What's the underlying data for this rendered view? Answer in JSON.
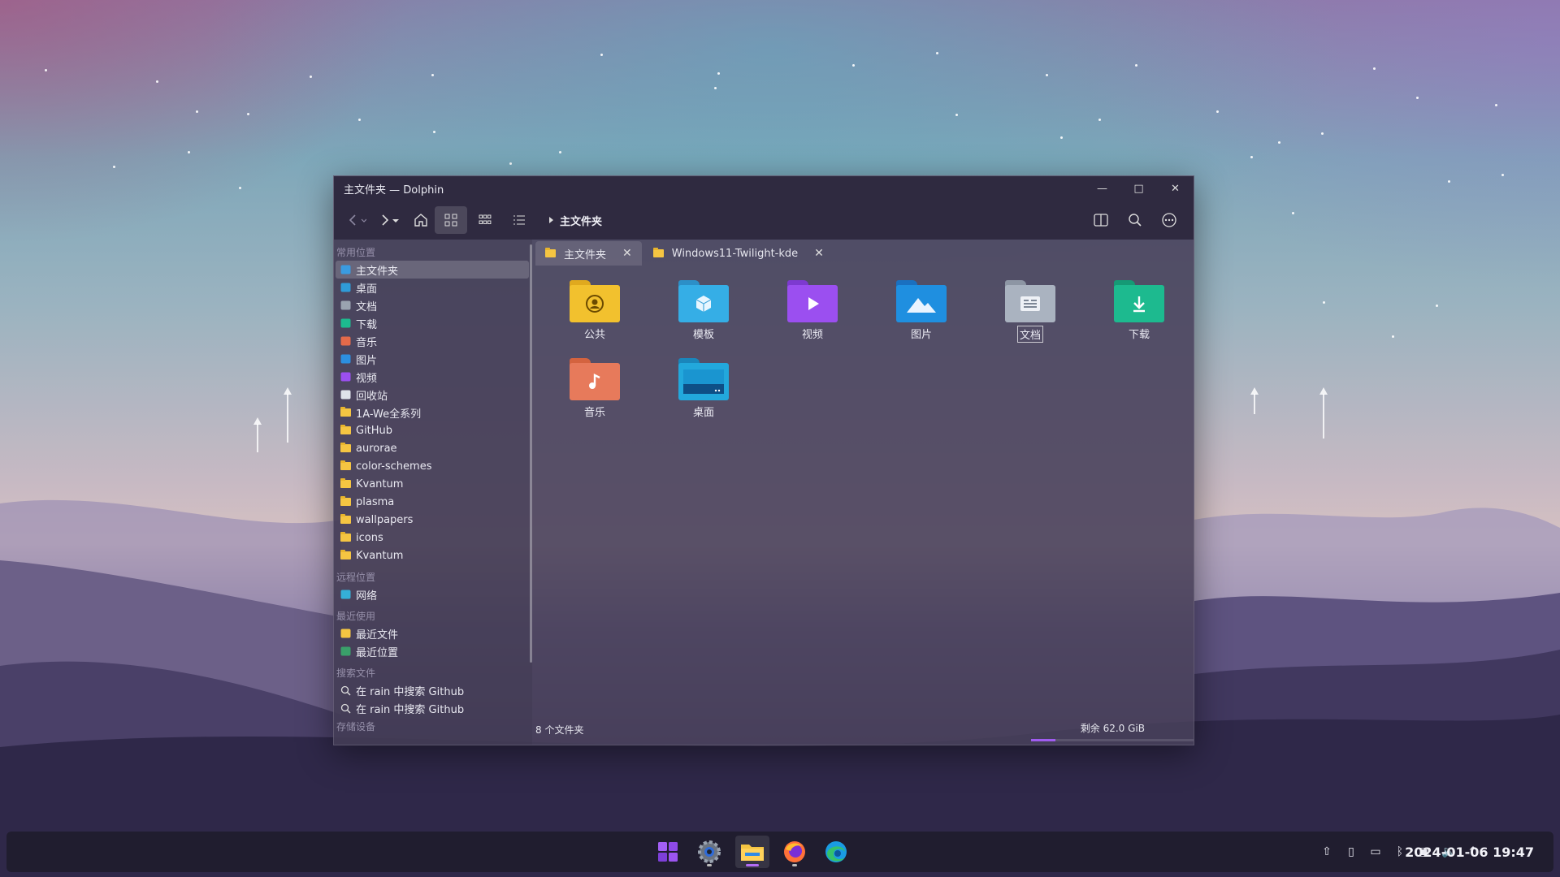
{
  "window": {
    "title": "主文件夹 — Dolphin",
    "minimize": "—",
    "maximize": "□",
    "close": "✕"
  },
  "toolbar": {
    "breadcrumb": "主文件夹"
  },
  "sidebar": {
    "sections": {
      "places": "常用位置",
      "remote": "远程位置",
      "recent": "最近使用",
      "search": "搜索文件",
      "devices": "存储设备"
    },
    "places": [
      {
        "label": "主文件夹",
        "icon": "home-icon"
      },
      {
        "label": "桌面",
        "icon": "desktop-icon"
      },
      {
        "label": "文档",
        "icon": "document-icon"
      },
      {
        "label": "下载",
        "icon": "download-icon"
      },
      {
        "label": "音乐",
        "icon": "music-icon"
      },
      {
        "label": "图片",
        "icon": "picture-icon"
      },
      {
        "label": "视频",
        "icon": "video-icon"
      },
      {
        "label": "回收站",
        "icon": "trash-icon"
      },
      {
        "label": "1A-We全系列",
        "icon": "folder-icon"
      },
      {
        "label": "GitHub",
        "icon": "folder-icon"
      },
      {
        "label": "aurorae",
        "icon": "folder-icon"
      },
      {
        "label": "color-schemes",
        "icon": "folder-icon"
      },
      {
        "label": "Kvantum",
        "icon": "folder-icon"
      },
      {
        "label": "plasma",
        "icon": "folder-icon"
      },
      {
        "label": "wallpapers",
        "icon": "folder-icon"
      },
      {
        "label": "icons",
        "icon": "folder-icon"
      },
      {
        "label": "Kvantum",
        "icon": "folder-icon"
      }
    ],
    "remote": [
      {
        "label": "网络",
        "icon": "network-icon"
      }
    ],
    "recent": [
      {
        "label": "最近文件",
        "icon": "recent-files-icon"
      },
      {
        "label": "最近位置",
        "icon": "recent-locations-icon"
      }
    ],
    "search": [
      {
        "label": "在 rain 中搜索 Github",
        "icon": "search-icon"
      },
      {
        "label": "在 rain 中搜索 Github",
        "icon": "search-icon"
      }
    ]
  },
  "tabs": [
    {
      "label": "主文件夹",
      "close": "✕"
    },
    {
      "label": "Windows11-Twilight-kde",
      "close": "✕"
    }
  ],
  "files": [
    {
      "label": "公共",
      "color": "#f2c12e",
      "back": "#e0a91e",
      "icon": "public-folder-icon"
    },
    {
      "label": "模板",
      "color": "#35aee6",
      "back": "#2c8fc7",
      "icon": "templates-folder-icon"
    },
    {
      "label": "视频",
      "color": "#9b4ff0",
      "back": "#7d3ad0",
      "icon": "videos-folder-icon"
    },
    {
      "label": "图片",
      "color": "#1f8fe0",
      "back": "#1a70c0",
      "icon": "pictures-folder-icon"
    },
    {
      "label": "文档",
      "color": "#aab3c0",
      "back": "#8d96a4",
      "icon": "documents-folder-icon"
    },
    {
      "label": "下载",
      "color": "#1dba8f",
      "back": "#159a75",
      "icon": "downloads-folder-icon"
    },
    {
      "label": "音乐",
      "color": "#e77a5b",
      "back": "#d4633f",
      "icon": "music-folder-icon"
    },
    {
      "label": "桌面",
      "color": "#22a8dc",
      "back": "#1a86bb",
      "icon": "desktop-folder-icon"
    }
  ],
  "status": {
    "count": "8 个文件夹",
    "free": "剩余 62.0 GiB",
    "used_fraction": 0.15
  },
  "taskbar": {
    "apps": [
      "start-icon",
      "settings-icon",
      "file-manager-icon",
      "firefox-icon",
      "edge-icon"
    ],
    "clock": "2024-01-06 19:47",
    "accent": "#b36cf5"
  }
}
